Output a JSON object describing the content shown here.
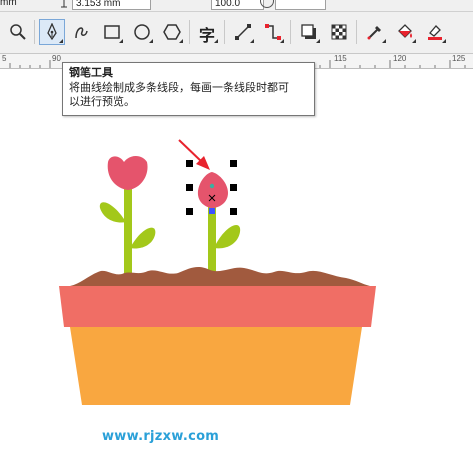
{
  "property_bar": {
    "unit": "mm",
    "height_value": "3.153 mm",
    "field_a": "100.0",
    "field_b": ""
  },
  "toolbar": {
    "tools": [
      {
        "name": "zoom-tool",
        "icon": "magnifier-icon"
      },
      {
        "name": "pen-tool",
        "icon": "pen-nib-icon",
        "active": true
      },
      {
        "name": "bspline-tool",
        "icon": "curve-icon"
      },
      {
        "name": "rectangle-tool",
        "icon": "rectangle-icon"
      },
      {
        "name": "ellipse-tool",
        "icon": "ellipse-icon"
      },
      {
        "name": "polygon-tool",
        "icon": "polygon-icon"
      },
      {
        "name": "text-tool",
        "icon": "text-icon",
        "glyph": "字"
      },
      {
        "name": "parallel-dimension-tool",
        "icon": "dimension-line-icon"
      },
      {
        "name": "connector-tool",
        "icon": "connector-icon"
      },
      {
        "name": "drop-shadow-tool",
        "icon": "drop-shadow-icon"
      },
      {
        "name": "transparency-tool",
        "icon": "checkerboard-icon"
      },
      {
        "name": "eyedropper-tool",
        "icon": "eyedropper-icon"
      },
      {
        "name": "interactive-fill-tool",
        "icon": "paint-bucket-icon"
      },
      {
        "name": "smart-fill-tool",
        "icon": "smart-fill-icon"
      }
    ]
  },
  "ruler": {
    "labels": [
      "5",
      "90",
      "115",
      "120",
      "125"
    ]
  },
  "tooltip": {
    "title": "钢笔工具",
    "description_line1": "将曲线绘制成多条线段，每画一条线段时都可",
    "description_line2": "以进行预览。"
  },
  "colors": {
    "pot_rim": "#f06e65",
    "pot_body": "#f9a740",
    "soil": "#a15a3e",
    "stem": "#a3c81a",
    "flower": "#e5546c",
    "arrow": "#e8232e",
    "watermark": "#2aa0d8"
  },
  "watermark": "www.rjzxw.com"
}
